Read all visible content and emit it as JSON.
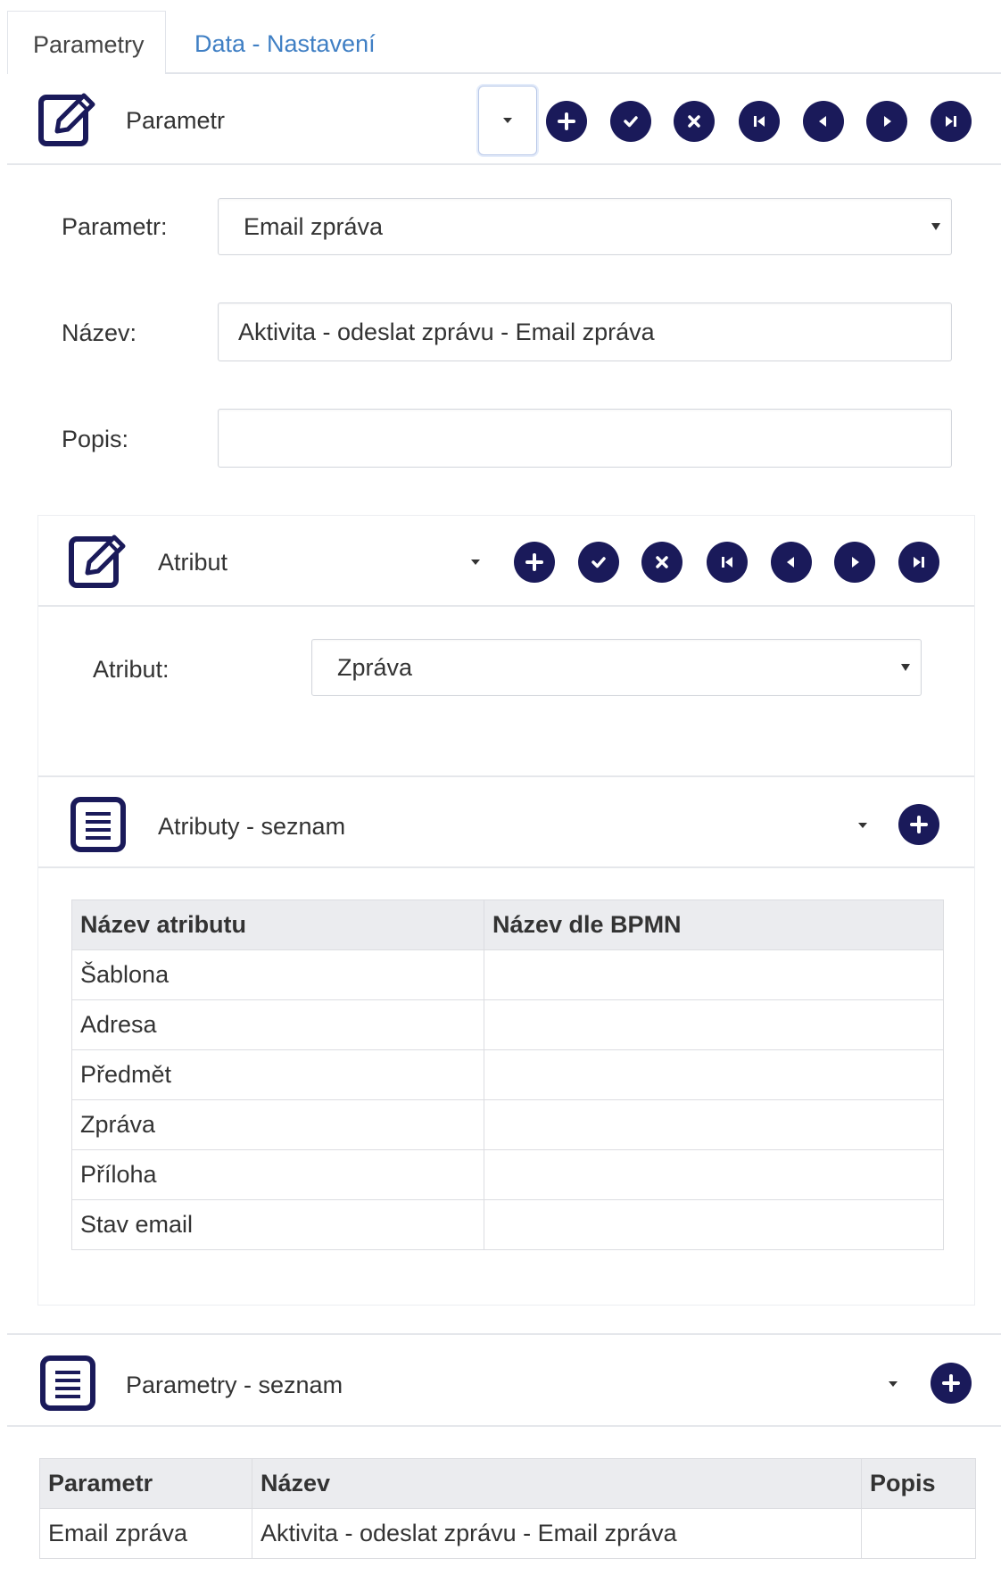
{
  "tabs": [
    {
      "label": "Parametry",
      "active": true
    },
    {
      "label": "Data - Nastavení",
      "active": false
    }
  ],
  "parametr_panel": {
    "title": "Parametr",
    "form": {
      "parametr_label": "Parametr:",
      "parametr_value": "Email zpráva",
      "nazev_label": "Název:",
      "nazev_value": "Aktivita - odeslat zprávu - Email zpráva",
      "popis_label": "Popis:",
      "popis_value": ""
    }
  },
  "atribut_panel": {
    "title": "Atribut",
    "form": {
      "atribut_label": "Atribut:",
      "atribut_value": "Zpráva"
    }
  },
  "atributy_list": {
    "title": "Atributy - seznam",
    "columns": [
      "Název atributu",
      "Název dle BPMN"
    ],
    "rows": [
      [
        "Šablona",
        ""
      ],
      [
        "Adresa",
        ""
      ],
      [
        "Předmět",
        ""
      ],
      [
        "Zpráva",
        ""
      ],
      [
        "Příloha",
        ""
      ],
      [
        "Stav email",
        ""
      ]
    ]
  },
  "parametry_list": {
    "title": "Parametry - seznam",
    "columns": [
      "Parametr",
      "Název",
      "Popis"
    ],
    "rows": [
      [
        "Email zpráva",
        "Aktivita - odeslat zprávu - Email zpráva",
        ""
      ]
    ]
  },
  "toolbar_icons": [
    "add-icon",
    "confirm-icon",
    "cancel-icon",
    "first-record-icon",
    "previous-record-icon",
    "next-record-icon",
    "last-record-icon"
  ],
  "colors": {
    "accent_dark": "#1a1a5a",
    "link": "#3f7fc4",
    "header_bg": "#ebecef",
    "panel_bg": "#f5f6f8"
  }
}
